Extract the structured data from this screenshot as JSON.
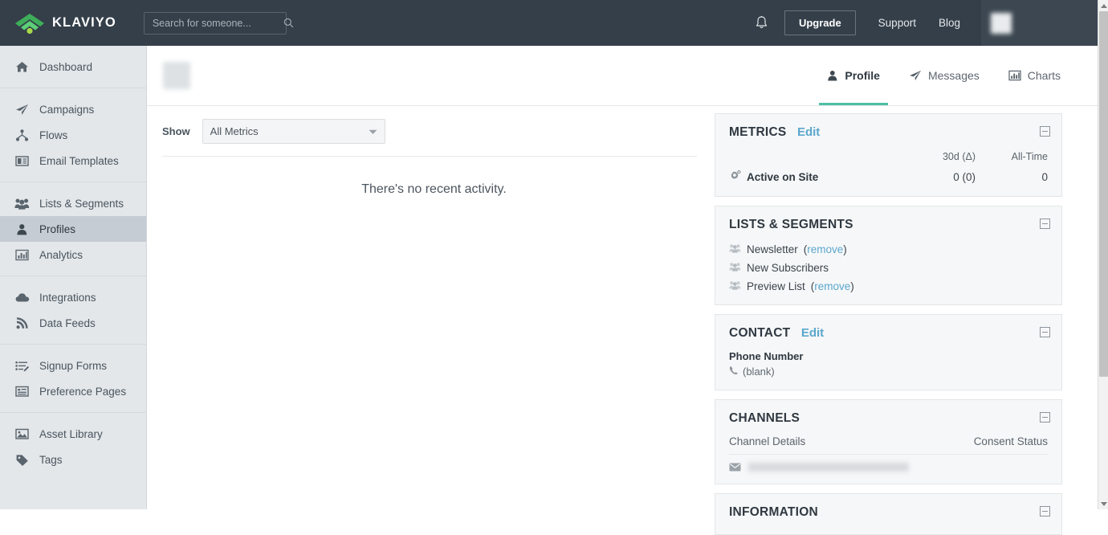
{
  "topnav": {
    "brand": "KLAVIYO",
    "logo_color": "#4ec46a",
    "background": "#343f49",
    "search": {
      "placeholder": "Search for someone...",
      "value": "",
      "icon": "search-icon"
    },
    "bell_icon": "notification-bell-icon",
    "upgrade_label": "Upgrade",
    "links": [
      {
        "label": "Support"
      },
      {
        "label": "Blog"
      }
    ],
    "account": {
      "name": "",
      "redacted": true,
      "avatar_icon": "user-avatar"
    }
  },
  "sidebar": {
    "groups": [
      {
        "items": [
          {
            "label": "Dashboard",
            "icon": "home-icon",
            "active": false
          }
        ]
      },
      {
        "items": [
          {
            "label": "Campaigns",
            "icon": "paper-plane-icon",
            "active": false
          },
          {
            "label": "Flows",
            "icon": "flow-branch-icon",
            "active": false
          },
          {
            "label": "Email Templates",
            "icon": "template-icon",
            "active": false
          }
        ]
      },
      {
        "items": [
          {
            "label": "Lists & Segments",
            "icon": "people-group-icon",
            "active": false
          },
          {
            "label": "Profiles",
            "icon": "person-icon",
            "active": true
          },
          {
            "label": "Analytics",
            "icon": "bar-chart-icon",
            "active": false
          }
        ]
      },
      {
        "items": [
          {
            "label": "Integrations",
            "icon": "cloud-icon",
            "active": false
          },
          {
            "label": "Data Feeds",
            "icon": "rss-feed-icon",
            "active": false
          }
        ]
      },
      {
        "items": [
          {
            "label": "Signup Forms",
            "icon": "form-list-icon",
            "active": false
          },
          {
            "label": "Preference Pages",
            "icon": "page-lines-icon",
            "active": false
          }
        ]
      },
      {
        "items": [
          {
            "label": "Asset Library",
            "icon": "image-icon",
            "active": false
          },
          {
            "label": "Tags",
            "icon": "tag-icon",
            "active": false
          }
        ]
      }
    ]
  },
  "profile_header": {
    "email": "",
    "email_redacted": true,
    "tabs": [
      {
        "label": "Profile",
        "icon": "person-icon",
        "active": true
      },
      {
        "label": "Messages",
        "icon": "paper-plane-icon",
        "active": false
      },
      {
        "label": "Charts",
        "icon": "bar-chart-icon",
        "active": false
      }
    ],
    "active_underline_color": "#4ebfa4"
  },
  "activity": {
    "show_label": "Show",
    "metric_filter_value": "All Metrics",
    "empty_message": "There's no recent activity."
  },
  "panels": {
    "metrics": {
      "title": "METRICS",
      "edit_label": "Edit",
      "columns": {
        "name": "",
        "col_30d": "30d (Δ)",
        "col_all_time": "All-Time"
      },
      "rows": [
        {
          "name": "Active on Site",
          "icon": "gear-activity-icon",
          "value_30d": "0 (0)",
          "value_all_time": "0"
        }
      ]
    },
    "lists_segments": {
      "title": "LISTS & SEGMENTS",
      "items": [
        {
          "name": "Newsletter",
          "icon": "people-group-icon",
          "remove_label": "remove",
          "removable": true
        },
        {
          "name": "New Subscribers",
          "icon": "people-group-icon",
          "remove_label": "",
          "removable": false
        },
        {
          "name": "Preview List",
          "icon": "people-group-icon",
          "remove_label": "remove",
          "removable": true
        }
      ]
    },
    "contact": {
      "title": "CONTACT",
      "edit_label": "Edit",
      "field_label": "Phone Number",
      "field_value": "(blank)",
      "field_icon": "phone-icon"
    },
    "channels": {
      "title": "CHANNELS",
      "col_details": "Channel Details",
      "col_consent": "Consent Status",
      "rows": [
        {
          "icon": "envelope-icon",
          "value": "",
          "redacted": true,
          "consent": ""
        }
      ]
    },
    "information": {
      "title": "INFORMATION"
    }
  },
  "accent_colors": {
    "link_blue": "#5aa7cd",
    "teal": "#4ebfa4",
    "nav_dark": "#343f49",
    "sidebar_bg": "#e3e7ea",
    "sidebar_active": "#c5ccd3",
    "panel_bg": "#f6f7f8"
  }
}
